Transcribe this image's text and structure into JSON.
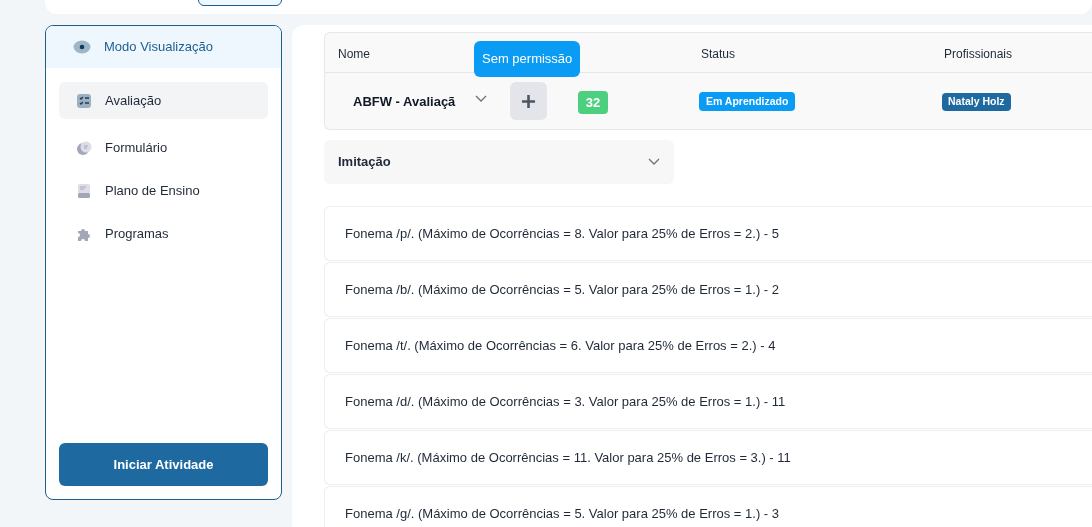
{
  "sidebar": {
    "mode": "Modo Visualização",
    "items": [
      {
        "label": "Avaliação",
        "selected": true
      },
      {
        "label": "Formulário",
        "selected": false
      },
      {
        "label": "Plano de Ensino",
        "selected": false
      },
      {
        "label": "Programas",
        "selected": false
      }
    ],
    "start_button": "Iniciar Atividade"
  },
  "table": {
    "columns": [
      "Nome",
      "Status",
      "Profissionais"
    ],
    "row": {
      "name": "ABFW - Avaliaçã",
      "count": "32",
      "status": "Em Aprendizado",
      "professional": "Nataly Holz"
    },
    "tooltip": "Sem permissão"
  },
  "section": {
    "title": "Imitação",
    "expanded": false
  },
  "items": [
    "Fonema /p/. (Máximo de Ocorrências = 8. Valor para 25% de Erros = 2.) - 5",
    "Fonema /b/. (Máximo de Ocorrências = 5. Valor para 25% de Erros = 1.) - 2",
    "Fonema /t/. (Máximo de Ocorrências = 6. Valor para 25% de Erros = 2.) - 4",
    "Fonema /d/. (Máximo de Ocorrências = 3. Valor para 25% de Erros = 1.) - 11",
    "Fonema /k/. (Máximo de Ocorrências = 11. Valor para 25% de Erros = 3.) - 11",
    "Fonema /g/. (Máximo de Ocorrências = 5. Valor para 25% de Erros = 1.) - 3"
  ]
}
